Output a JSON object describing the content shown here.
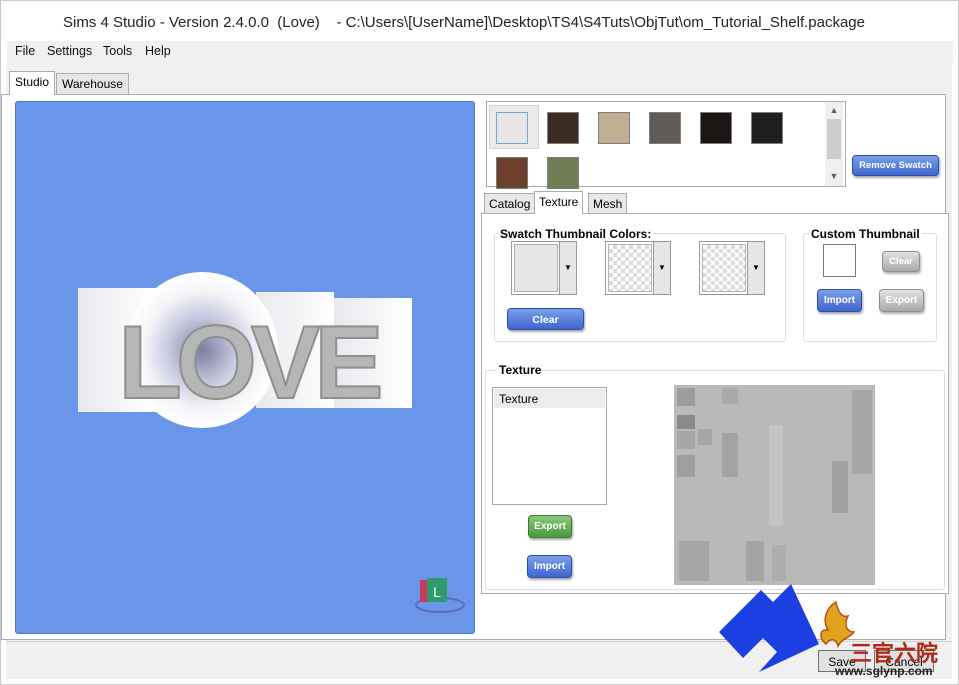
{
  "window": {
    "title": "Sims 4 Studio - Version 2.4.0.0  (Love)    - C:\\Users\\[UserName]\\Desktop\\TS4\\S4Tuts\\ObjTut\\om_Tutorial_Shelf.package"
  },
  "menu": {
    "items": [
      "File",
      "Settings",
      "Tools",
      "Help"
    ]
  },
  "main_tabs": [
    {
      "label": "Studio",
      "active": true
    },
    {
      "label": "Warehouse",
      "active": false
    }
  ],
  "viewport": {
    "background": "#6a96e9",
    "model_text": "LOVE",
    "gizmo_letter": "L"
  },
  "swatches": {
    "colors": [
      "#e6e6e6",
      "#3b2b22",
      "#c2ae93",
      "#605b57",
      "#1c1714",
      "#1e1e1e",
      "#6c402a",
      "#717e55"
    ],
    "remove_label": "Remove Swatch"
  },
  "sub_tabs": [
    {
      "label": "Catalog",
      "active": false
    },
    {
      "label": "Texture",
      "active": true
    },
    {
      "label": "Mesh",
      "active": false
    }
  ],
  "swatch_thumbnail": {
    "label": "Swatch Thumbnail Colors:",
    "clear_label": "Clear",
    "pickers": [
      {
        "color": "#e6e6e6",
        "empty": false
      },
      {
        "empty": true
      },
      {
        "empty": true
      }
    ]
  },
  "custom_thumbnail": {
    "label": "Custom Thumbnail",
    "clear_label": "Clear",
    "import_label": "Import",
    "export_label": "Export"
  },
  "texture": {
    "label": "Texture",
    "list_items": [
      "Texture"
    ],
    "export_label": "Export",
    "import_label": "Import"
  },
  "footer": {
    "save_label": "Save",
    "cancel_label": "Cancel"
  },
  "watermark": {
    "text": "三官六院",
    "url": "www.sglynp.com"
  }
}
